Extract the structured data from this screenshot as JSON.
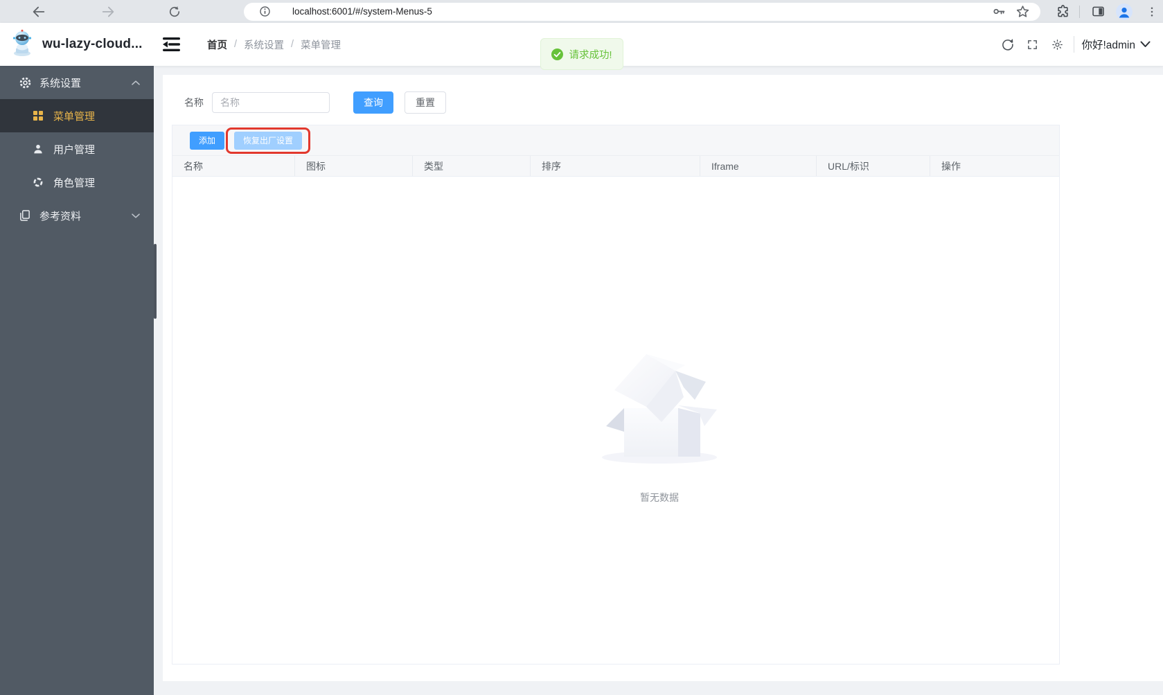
{
  "browser": {
    "url": "localhost:6001/#/system-Menus-5"
  },
  "app": {
    "title": "wu-lazy-cloud...",
    "greeting": "你好!admin"
  },
  "breadcrumb": {
    "items": [
      "首页",
      "系统设置",
      "菜单管理"
    ],
    "separator": "/"
  },
  "toast": {
    "message": "请求成功!"
  },
  "search": {
    "label": "名称",
    "placeholder": "名称",
    "value": "",
    "query": "查询",
    "reset": "重置"
  },
  "toolbar": {
    "add": "添加",
    "restore": "恢复出厂设置"
  },
  "table": {
    "columns": [
      "名称",
      "图标",
      "类型",
      "排序",
      "Iframe",
      "URL/标识",
      "操作"
    ],
    "rows": [],
    "empty": "暂无数据"
  },
  "sidebar": {
    "groups": [
      {
        "label": "系统设置",
        "icon": "gear-icon",
        "expanded": true,
        "children": [
          {
            "label": "菜单管理",
            "icon": "grid-icon",
            "active": true
          },
          {
            "label": "用户管理",
            "icon": "user-icon",
            "active": false
          },
          {
            "label": "角色管理",
            "icon": "roles-icon",
            "active": false
          }
        ]
      },
      {
        "label": "参考资料",
        "icon": "documents-icon",
        "expanded": false,
        "children": []
      }
    ]
  },
  "icons": {
    "browser": [
      "back-icon",
      "forward-icon",
      "reload-icon",
      "info-icon",
      "key-icon",
      "star-icon",
      "extensions-icon",
      "side-panel-icon",
      "profile-avatar-icon",
      "kebab-menu-icon"
    ],
    "header": [
      "app-logo-icon",
      "collapse-menu-icon",
      "refresh-icon",
      "fullscreen-icon",
      "theme-sun-icon",
      "chevron-down-icon"
    ],
    "toast": "check-circle-icon",
    "empty_state": "empty-box-illustration"
  },
  "colors": {
    "accent": "#409eff",
    "accent-disabled": "#a0cfff",
    "success": "#67c23a",
    "success-bg": "#f0f9eb",
    "success-border": "#e1f3d8",
    "sidebar-bg": "#515a64",
    "sidebar-active-bg": "#30353c",
    "sidebar-active-text": "#e9b54a",
    "annotation-red": "#e2382d",
    "page-bg": "#f0f2f5"
  }
}
